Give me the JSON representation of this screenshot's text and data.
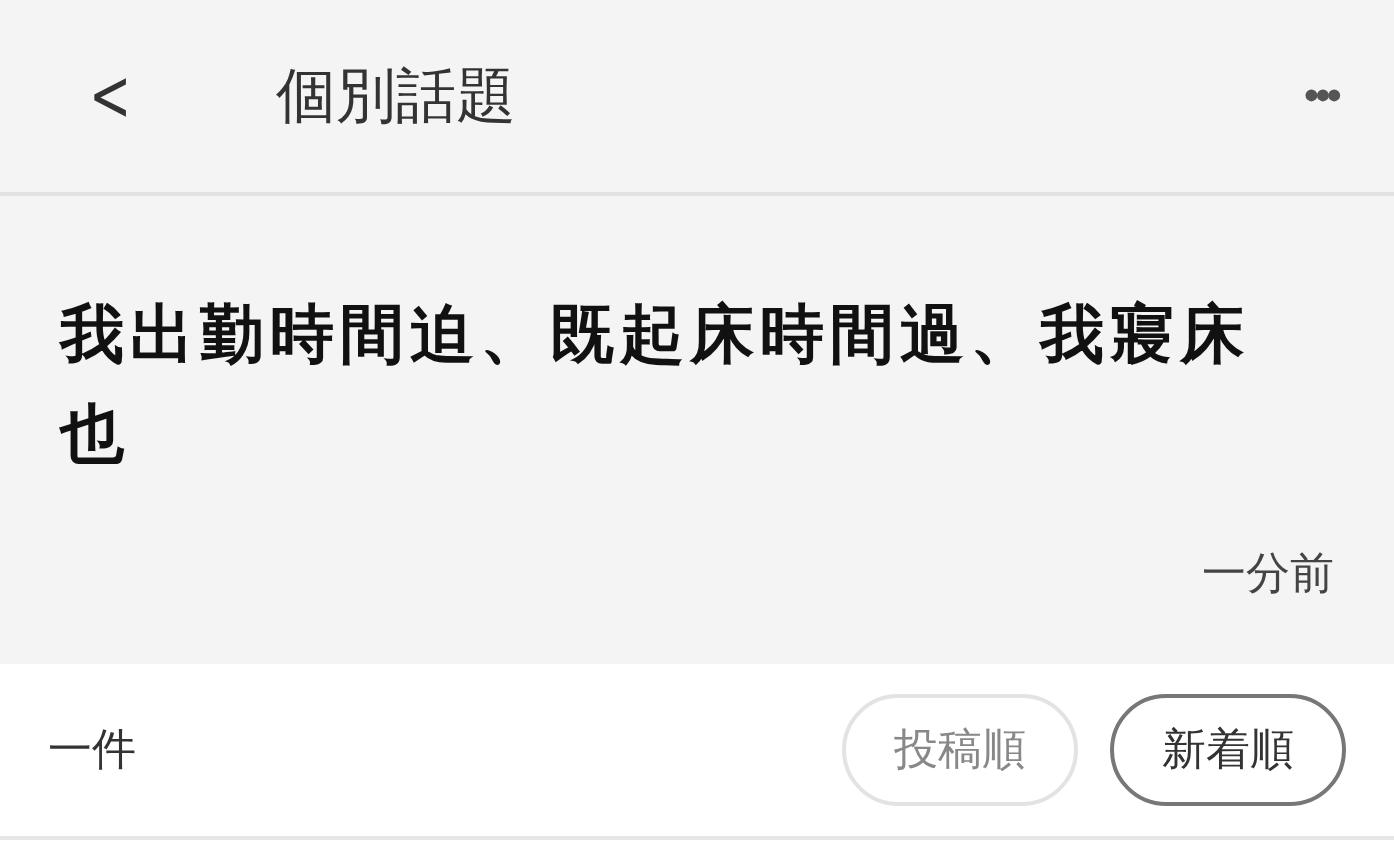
{
  "header": {
    "back": "<",
    "title": "個別話題",
    "menu": "•••"
  },
  "post": {
    "text": "我出勤時間迫、既起床時間過、我寢床也",
    "time": "一分前"
  },
  "footer": {
    "count": "一件",
    "sort": [
      {
        "label": "投稿順",
        "selected": false
      },
      {
        "label": "新着順",
        "selected": true
      }
    ]
  }
}
